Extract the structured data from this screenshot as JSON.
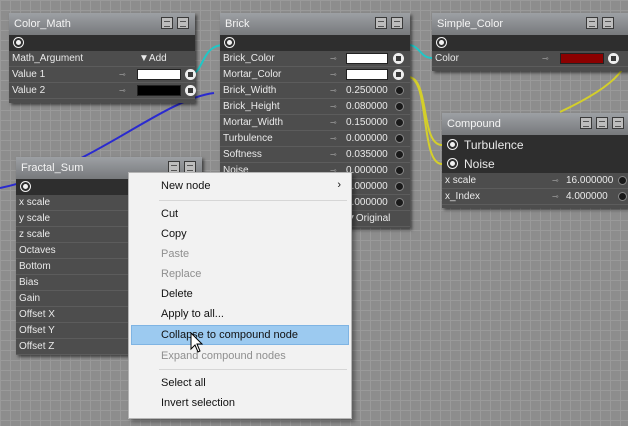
{
  "nodes": {
    "color_math": {
      "title": "Color_Math",
      "rows": [
        {
          "label": "Math_Argument",
          "value": "▼Add"
        },
        {
          "label": "Value 1"
        },
        {
          "label": "Value 2"
        }
      ],
      "colors": {
        "value1": "#ffffff",
        "value2": "#000000"
      }
    },
    "brick": {
      "title": "Brick",
      "rows": [
        {
          "label": "Brick_Color",
          "value": ""
        },
        {
          "label": "Mortar_Color",
          "value": ""
        },
        {
          "label": "Brick_Width",
          "value": "0.250000"
        },
        {
          "label": "Brick_Height",
          "value": "0.080000"
        },
        {
          "label": "Mortar_Width",
          "value": "0.150000"
        },
        {
          "label": "Turbulence",
          "value": "0.000000"
        },
        {
          "label": "Softness",
          "value": "0.035000"
        },
        {
          "label": "Noise",
          "value": "0.000000"
        },
        {
          "label": "",
          "value": "0.000000"
        },
        {
          "label": "",
          "value": "0.000000"
        },
        {
          "label": "",
          "value": "▼Original"
        }
      ]
    },
    "simple_color": {
      "title": "Simple_Color",
      "rows": [
        {
          "label": "Color"
        }
      ],
      "colors": {
        "color": "#8b0000"
      }
    },
    "compound": {
      "title": "Compound",
      "inputs": [
        "Turbulence",
        "Noise"
      ],
      "rows": [
        {
          "label": "x scale",
          "value": "16.000000"
        },
        {
          "label": "x_Index",
          "value": "4.000000"
        }
      ]
    },
    "fractal_sum": {
      "title": "Fractal_Sum",
      "rows": [
        "x scale",
        "y scale",
        "z scale",
        "Octaves",
        "Bottom",
        "Bias",
        "Gain",
        "Offset X",
        "Offset Y",
        "Offset Z"
      ]
    }
  },
  "context_menu": {
    "items": [
      {
        "label": "New node",
        "submenu": "›",
        "enabled": true
      },
      {
        "label": "Cut",
        "enabled": true
      },
      {
        "label": "Copy",
        "enabled": true
      },
      {
        "label": "Paste",
        "enabled": false
      },
      {
        "label": "Replace",
        "enabled": false
      },
      {
        "label": "Delete",
        "enabled": true
      },
      {
        "label": "Apply to all...",
        "enabled": true
      },
      {
        "label": "Collapse to compound node",
        "enabled": true,
        "highlighted": true
      },
      {
        "label": "Expand compound nodes",
        "enabled": false
      },
      {
        "label": "Select all",
        "enabled": true
      },
      {
        "label": "Invert selection",
        "enabled": true
      }
    ]
  },
  "colors": {
    "canvas": "#8d8d8d",
    "node_body": "#4d4d4d",
    "wire_cyan": "#1fc7c7",
    "wire_blue": "#2a2ad0",
    "wire_yellow": "#d4cf2a",
    "menu_highlight": "#9ccaf0"
  }
}
